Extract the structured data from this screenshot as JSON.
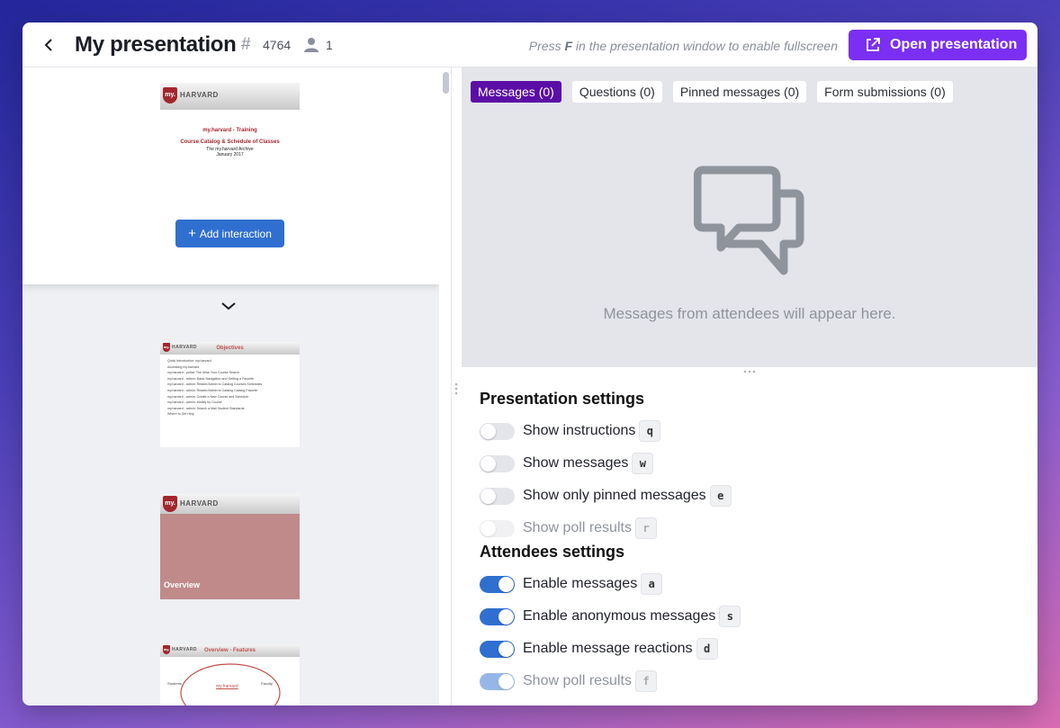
{
  "header": {
    "title": "My presentation",
    "hash": "#",
    "code": "4764",
    "attendee_count": "1",
    "hint_prefix": "Press ",
    "hint_key": "F",
    "hint_suffix": " in the presentation window to enable fullscreen",
    "open_button": "Open presentation"
  },
  "slides": {
    "current": {
      "logo": "my.",
      "org": "HARVARD",
      "line1": "my.harvard - Training",
      "line2": "Course Catalog & Schedule of Classes",
      "line3": "The my.harvard Archive",
      "line4": "January 2017",
      "add_button": "Add interaction"
    },
    "thumb2": {
      "logo": "my.",
      "org": "HARVARD",
      "title": "Objectives",
      "bullets": [
        "Quick Introduction: my.harvard",
        "Accessing my.harvard",
        "my.harvard - portal: The Mine Your Course Search",
        "my.harvard - admin: Basic Navigation and Getting a Favorite",
        "my.harvard - admin: Reader/Admin to Catalog Courses Schedules",
        "my.harvard - admin: Reader/Admin to Catalog Catalog Favorite",
        "my.harvard - admin: Create a New Course and Schedule",
        "my.harvard - admin: Modify by Course",
        "my.harvard - admin: Search a Mail Student Standards",
        "Where to Get Help"
      ]
    },
    "thumb3": {
      "logo": "my.",
      "org": "HARVARD",
      "caption": "Overview"
    },
    "thumb4": {
      "logo": "my.",
      "org": "HARVARD",
      "title": "Overview - Features",
      "center_label": "my.harvard",
      "left_head": "Students",
      "right_head": "Faculty"
    }
  },
  "messages": {
    "tabs": [
      {
        "label": "Messages (0)",
        "active": true
      },
      {
        "label": "Questions (0)",
        "active": false
      },
      {
        "label": "Pinned messages (0)",
        "active": false
      },
      {
        "label": "Form submissions (0)",
        "active": false
      }
    ],
    "empty_text": "Messages from attendees will appear here."
  },
  "presentation_settings": {
    "title": "Presentation settings",
    "rows": [
      {
        "label": "Show instructions",
        "key": "q",
        "on": false,
        "disabled": false
      },
      {
        "label": "Show messages",
        "key": "w",
        "on": false,
        "disabled": false
      },
      {
        "label": "Show only pinned messages",
        "key": "e",
        "on": false,
        "disabled": false
      },
      {
        "label": "Show poll results",
        "key": "r",
        "on": false,
        "disabled": true
      }
    ]
  },
  "attendees_settings": {
    "title": "Attendees settings",
    "rows": [
      {
        "label": "Enable messages",
        "key": "a",
        "on": true,
        "disabled": false
      },
      {
        "label": "Enable anonymous messages",
        "key": "s",
        "on": true,
        "disabled": false
      },
      {
        "label": "Enable message reactions",
        "key": "d",
        "on": true,
        "disabled": false
      },
      {
        "label": "Show poll results",
        "key": "f",
        "on": true,
        "disabled": true
      }
    ]
  },
  "colors": {
    "accent": "#7b2ff2",
    "tab_active": "#5b0ea6",
    "toggle_on": "#2f6fd0",
    "harvard_red": "#a3262e"
  }
}
